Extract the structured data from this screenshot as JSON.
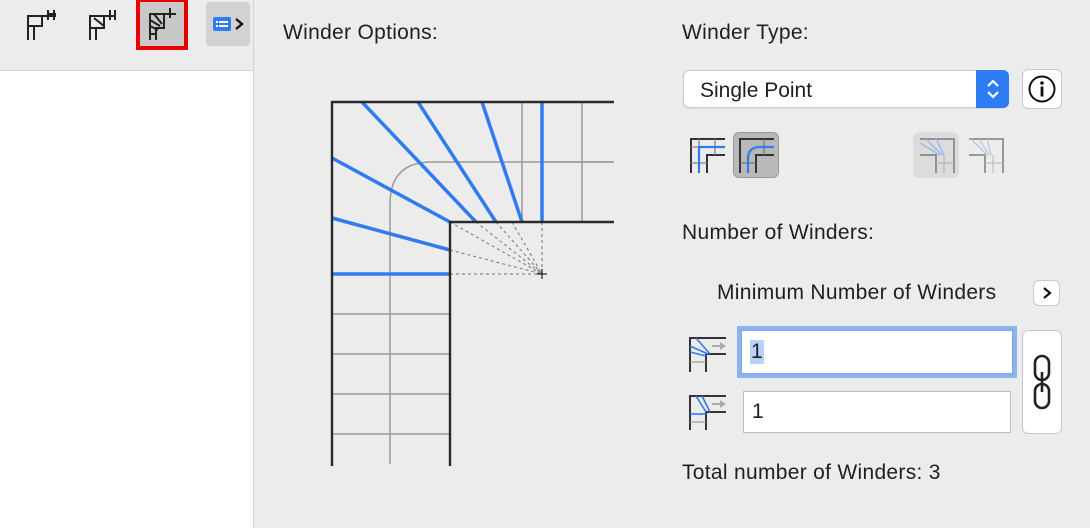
{
  "toolbar": {
    "buttons": [
      {
        "icon": "straight-stair-icon"
      },
      {
        "icon": "landing-stair-icon"
      },
      {
        "icon": "winder-stair-icon",
        "selected": true
      }
    ],
    "more_icon": "panel-list-icon"
  },
  "winder_options": {
    "title": "Winder Options:"
  },
  "winder_type": {
    "title": "Winder Type:",
    "selected_value": "Single Point",
    "type_icons": [
      "winder-type-1-icon",
      "winder-type-2-icon",
      "winder-type-3-icon",
      "winder-type-4-icon"
    ]
  },
  "number_of_winders": {
    "title": "Number of Winders:",
    "minimum_label": "Minimum Number of Winders",
    "field_1_value": "1",
    "field_2_value": "1",
    "total_label": "Total number of Winders: 3"
  },
  "colors": {
    "accent": "#2d7cf4",
    "highlight": "#e60000",
    "winder_line": "#2f7cf0"
  }
}
